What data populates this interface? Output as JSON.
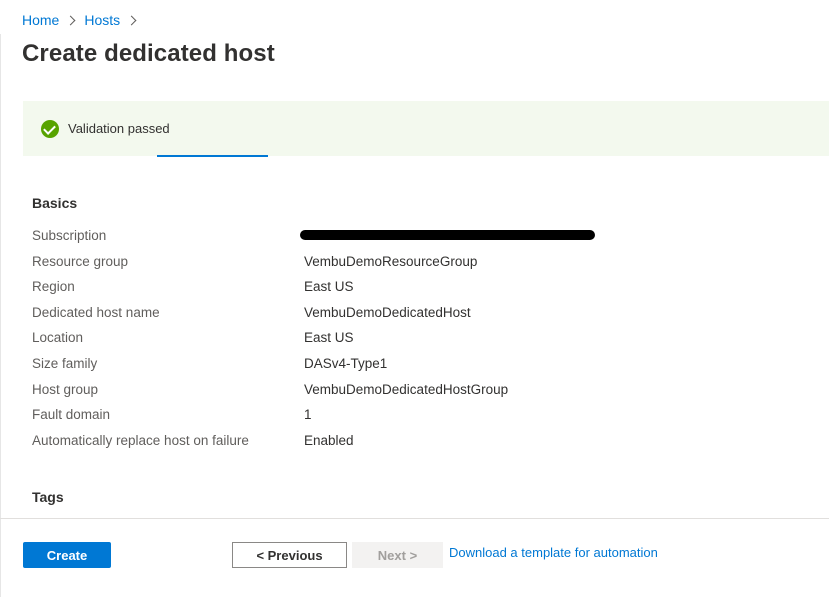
{
  "breadcrumb": [
    {
      "label": "Home"
    },
    {
      "label": "Hosts"
    }
  ],
  "page_title": "Create dedicated host",
  "validation": {
    "message": "Validation passed",
    "status_color": "#57a300"
  },
  "basics": {
    "heading": "Basics",
    "rows": [
      {
        "label": "Subscription",
        "value": ""
      },
      {
        "label": "Resource group",
        "value": "VembuDemoResourceGroup"
      },
      {
        "label": "Region",
        "value": "East US"
      },
      {
        "label": "Dedicated host name",
        "value": "VembuDemoDedicatedHost"
      },
      {
        "label": "Location",
        "value": "East US"
      },
      {
        "label": "Size family",
        "value": "DASv4-Type1"
      },
      {
        "label": "Host group",
        "value": "VembuDemoDedicatedHostGroup"
      },
      {
        "label": "Fault domain",
        "value": "1"
      },
      {
        "label": "Automatically replace host on failure",
        "value": "Enabled"
      }
    ]
  },
  "tags": {
    "heading": "Tags"
  },
  "footer": {
    "create_label": "Create",
    "previous_label": "< Previous",
    "next_label": "Next >",
    "download_link": "Download a template for automation"
  },
  "colors": {
    "accent": "#0078d4",
    "banner_bg": "#f3f9ee"
  }
}
